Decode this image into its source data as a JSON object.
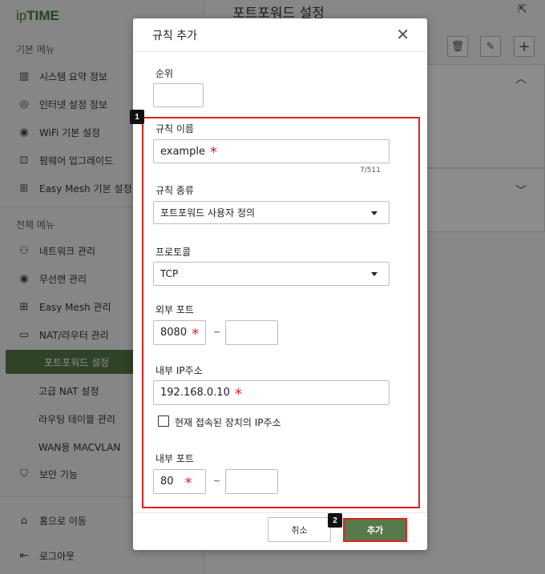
{
  "app": {
    "logo": "ipTIME",
    "page_title": "포트포워드 설정"
  },
  "sidebar": {
    "basic_section": "기본 메뉴",
    "basic_items": [
      {
        "label": "시스템 요약 정보",
        "icon": "bar-chart-icon"
      },
      {
        "label": "인터넷 설정 정보",
        "icon": "globe-icon"
      },
      {
        "label": "WiFi 기본 설정",
        "icon": "wifi-icon"
      },
      {
        "label": "펌웨어 업그레이드",
        "icon": "upgrade-icon"
      },
      {
        "label": "Easy Mesh 기본 설정",
        "icon": "mesh-icon"
      }
    ],
    "all_section": "전체 메뉴",
    "all_items": [
      {
        "label": "네트워크 관리",
        "icon": "network-icon"
      },
      {
        "label": "무선랜 관리",
        "icon": "wireless-icon"
      },
      {
        "label": "Easy Mesh 관리",
        "icon": "mesh-icon"
      },
      {
        "label": "NAT/라우터 관리",
        "icon": "router-icon"
      }
    ],
    "sub_items": [
      {
        "label": "포트포워드 설정",
        "active": true
      },
      {
        "label": "고급 NAT 설정"
      },
      {
        "label": "라우팅 테이블 관리"
      },
      {
        "label": "WAN용 MACVLAN"
      }
    ],
    "security": {
      "label": "보안 기능",
      "icon": "shield-icon"
    },
    "home": {
      "label": "홈으로 이동",
      "icon": "home-icon"
    },
    "logout": {
      "label": "로그아웃",
      "icon": "logout-icon"
    }
  },
  "dialog": {
    "title": "규칙 추가",
    "order_label": "순위",
    "order_value": "",
    "rule_name_label": "규칙 이름",
    "rule_name_value": "example",
    "rule_name_counter": "7/511",
    "rule_type_label": "규칙 종류",
    "rule_type_value": "포트포워드 사용자 정의",
    "protocol_label": "프로토콜",
    "protocol_value": "TCP",
    "ext_port_label": "외부 포트",
    "ext_port_start": "8080",
    "ext_port_end": "",
    "int_ip_label": "내부 IP주소",
    "int_ip_value": "192.168.0.10",
    "current_ip_checkbox_label": "현재 접속된 장치의 IP주소",
    "current_ip_checked": false,
    "int_port_label": "내부 포트",
    "int_port_start": "80",
    "int_port_end": "",
    "tilde": "~",
    "required_mark": "*",
    "cancel_label": "취소",
    "add_label": "추가"
  },
  "annotations": {
    "badge1": "1",
    "badge2": "2",
    "highlight_color": "#e02020"
  },
  "colors": {
    "accent": "#587a4a",
    "required": "#e02020"
  }
}
